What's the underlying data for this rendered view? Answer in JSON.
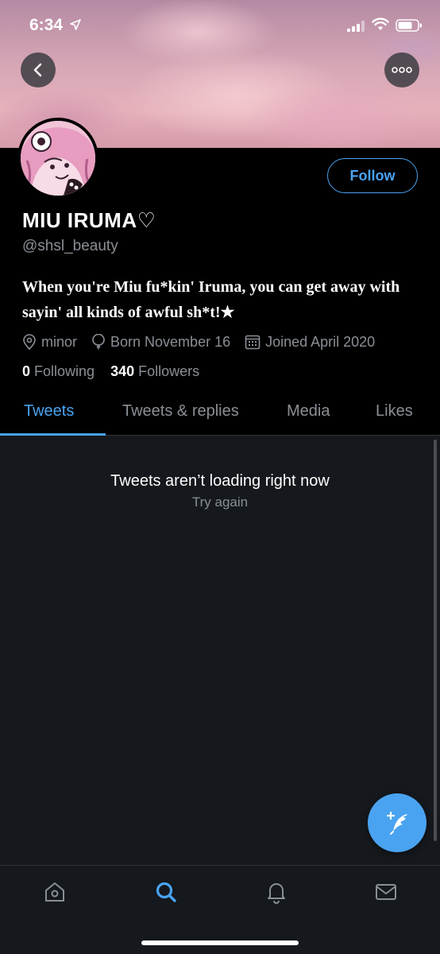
{
  "status_bar": {
    "time": "6:34"
  },
  "profile": {
    "display_name": "MIU IRUMA♡",
    "handle": "@shsl_beauty",
    "bio": "When you're Miu fu*kin' Iruma, you can get away with sayin' all kinds of awful sh*t!★",
    "location": "minor",
    "birthday": "Born November 16",
    "joined": "Joined April 2020",
    "following_count": "0",
    "following_label": "Following",
    "followers_count": "340",
    "followers_label": "Followers",
    "follow_button": "Follow"
  },
  "tabs": [
    {
      "label": "Tweets",
      "active": true
    },
    {
      "label": "Tweets & replies",
      "active": false
    },
    {
      "label": "Media",
      "active": false
    },
    {
      "label": "Likes",
      "active": false
    }
  ],
  "feed": {
    "error_title": "Tweets aren’t loading right now",
    "retry_label": "Try again"
  },
  "bottom_nav": {
    "items": [
      "home-icon",
      "search-icon",
      "bell-icon",
      "mail-icon"
    ],
    "active": "search-icon"
  },
  "colors": {
    "accent": "#4aa3f0",
    "background": "#15181c",
    "profile_background": "#000000",
    "muted_text": "#8a8f96"
  }
}
